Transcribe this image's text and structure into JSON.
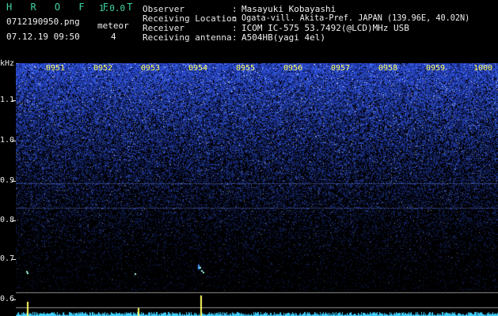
{
  "app": {
    "title": "H R O F F T",
    "version": "1.0.0",
    "filename": "0712190950.png",
    "datetime": "07.12.19 09:50",
    "meteor_label": "meteor",
    "meteor_count": "4"
  },
  "info": [
    {
      "label": "Observer",
      "value": "Masayuki Kobayashi"
    },
    {
      "label": "Receiving Location",
      "value": "Ogata-vill. Akita-Pref. JAPAN (139.96E, 40.02N)"
    },
    {
      "label": "Receiver",
      "value": "ICOM IC-575 53.7492(@LCD)MHz USB"
    },
    {
      "label": "Receiving antenna",
      "value": "A504HB(yagi 4el)"
    }
  ],
  "spectrogram": {
    "y_unit": "kHz",
    "y_ticks": [
      "1.1",
      "1.0",
      "0.9",
      "0.8",
      "0.7",
      "0.6"
    ],
    "time_ticks": [
      "0951",
      "0952",
      "0953",
      "0954",
      "0955",
      "0956",
      "0957",
      "0958",
      "0959",
      "1000"
    ],
    "colors": {
      "noise": "#3a5cff",
      "tick": "#ffff60",
      "meteor": "#7fffd4",
      "baseline": "#a0a0a0"
    }
  }
}
